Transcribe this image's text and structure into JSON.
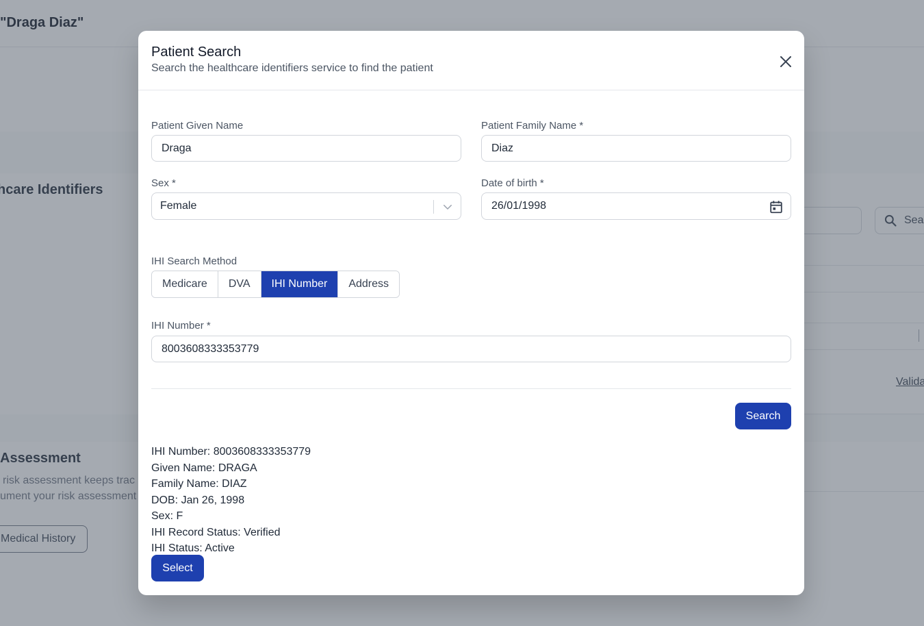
{
  "background": {
    "page_title": "\"Draga Diaz\"",
    "healthcare_identifiers_heading": "hcare Identifiers",
    "risk_assessment_heading": "Assessment",
    "risk_assessment_line1": "risk assessment keeps trac",
    "risk_assessment_line2": "ument your risk assessment",
    "medical_history_button": "Medical History",
    "search_button": "Sea",
    "validate_link": "Valida"
  },
  "modal": {
    "title": "Patient Search",
    "subtitle": "Search the healthcare identifiers service to find the patient",
    "given_name": {
      "label": "Patient Given Name",
      "value": "Draga"
    },
    "family_name": {
      "label": "Patient Family Name *",
      "value": "Diaz"
    },
    "sex": {
      "label": "Sex *",
      "value": "Female"
    },
    "dob": {
      "label": "Date of birth *",
      "value": "26/01/1998"
    },
    "search_method": {
      "label": "IHI Search Method",
      "options": [
        "Medicare",
        "DVA",
        "IHI Number",
        "Address"
      ],
      "selected": "IHI Number"
    },
    "ihi_number": {
      "label": "IHI Number *",
      "value": "8003608333353779"
    },
    "search_button": "Search",
    "result": {
      "ihi_number": "IHI Number: 8003608333353779",
      "given_name": "Given Name: DRAGA",
      "family_name": "Family Name: DIAZ",
      "dob": "DOB: Jan 26, 1998",
      "sex": "Sex: F",
      "record_status": "IHI Record Status: Verified",
      "ihi_status": "IHI Status: Active"
    },
    "select_button": "Select"
  },
  "colors": {
    "primary": "#1e40af",
    "overlay": "rgba(75, 85, 99, 0.5)"
  }
}
